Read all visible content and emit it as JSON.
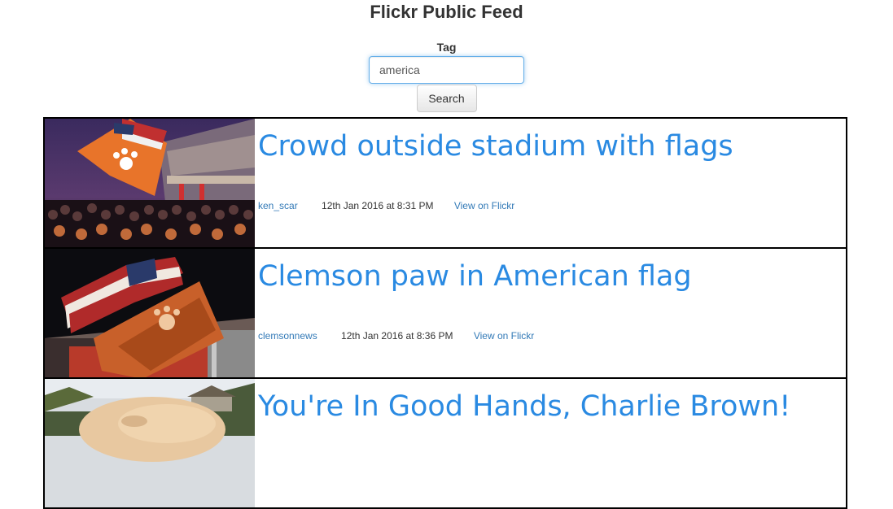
{
  "header": {
    "title": "Flickr Public Feed"
  },
  "search": {
    "label": "Tag",
    "value": "america",
    "button_label": "Search"
  },
  "feed": {
    "items": [
      {
        "title": "Crowd outside stadium with flags",
        "author": "ken_scar",
        "date": "12th Jan 2016 at 8:31 PM",
        "link_label": "View on Flickr"
      },
      {
        "title": "Clemson paw in American flag",
        "author": "clemsonnews",
        "date": "12th Jan 2016 at 8:36 PM",
        "link_label": "View on Flickr"
      },
      {
        "title": "You're In Good Hands, Charlie Brown!",
        "author": "",
        "date": "",
        "link_label": ""
      }
    ]
  },
  "colors": {
    "title_link": "#2a8ae2",
    "meta_link": "#337ab7",
    "item_border": "#000000",
    "input_focus": "#66afe9"
  }
}
